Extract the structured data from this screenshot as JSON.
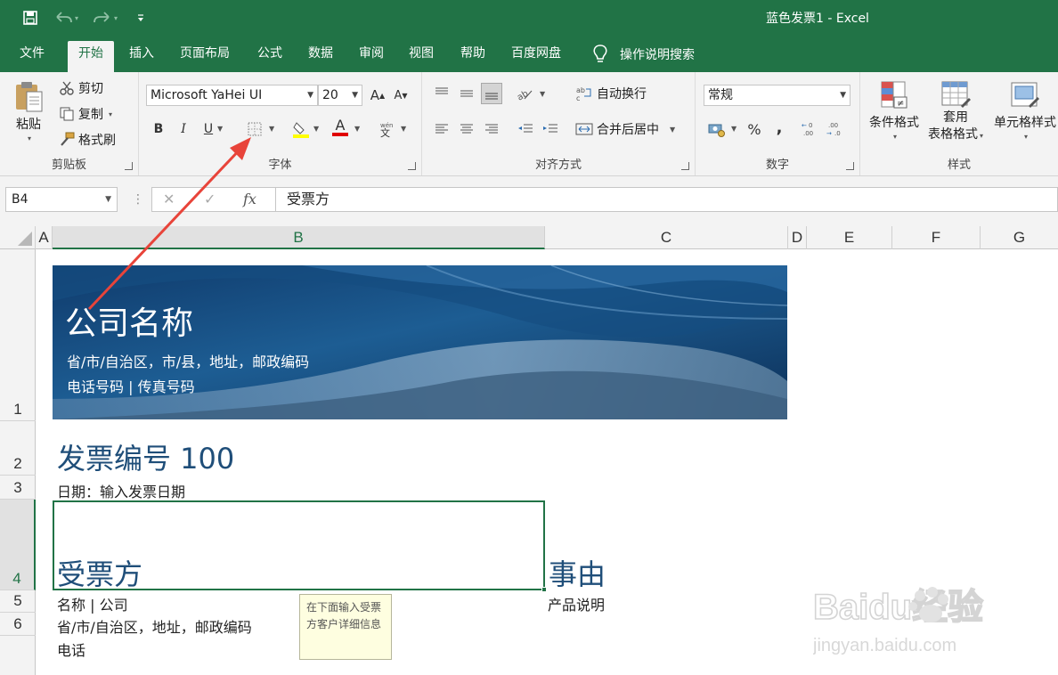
{
  "window": {
    "title": "蓝色发票1  -  Excel"
  },
  "tabs": [
    "文件",
    "开始",
    "插入",
    "页面布局",
    "公式",
    "数据",
    "审阅",
    "视图",
    "帮助",
    "百度网盘"
  ],
  "active_tab": "开始",
  "tell_me": "操作说明搜索",
  "clipboard": {
    "paste": "粘贴",
    "cut": "剪切",
    "copy": "复制",
    "format_painter": "格式刷",
    "label": "剪贴板"
  },
  "font": {
    "name": "Microsoft YaHei UI",
    "size": "20",
    "bold": "B",
    "italic": "I",
    "underline": "U",
    "font_color_glyph": "A",
    "label": "字体"
  },
  "alignment": {
    "wrap_text": "自动换行",
    "merge_center": "合并后居中",
    "label": "对齐方式"
  },
  "number": {
    "format": "常规",
    "percent": "%",
    "comma": ",",
    "label": "数字"
  },
  "styles": {
    "conditional": "条件格式",
    "table_line1": "套用",
    "table_line2": "表格格式",
    "cell_styles": "单元格样式",
    "label": "样式"
  },
  "formula_bar": {
    "name_box": "B4",
    "fx": "fx",
    "value": "受票方"
  },
  "columns": [
    "A",
    "B",
    "C",
    "D",
    "E",
    "F",
    "G"
  ],
  "selected_column": "B",
  "rows": [
    "1",
    "2",
    "3",
    "4",
    "5",
    "6"
  ],
  "selected_row": "4",
  "sheet": {
    "company_name": "公司名称",
    "address_line": "省/市/自治区，市/县，地址，邮政编码",
    "phone_line": "电话号码 | 传真号码",
    "invoice_no": "发票编号 100",
    "date": "日期：输入发票日期",
    "recipient": "受票方",
    "reason": "事由",
    "name_company": "名称 | 公司",
    "product_desc": "产品说明",
    "recipient_address": "省/市/自治区，地址，邮政编码",
    "phone": "电话",
    "tooltip": "在下面输入受票方客户详细信息"
  },
  "watermark": {
    "brand": "Baidu经验",
    "url": "jingyan.baidu.com"
  },
  "colors": {
    "excel_green": "#217346",
    "heading_blue": "#1f4e79",
    "arrow_red": "#e8443a"
  }
}
